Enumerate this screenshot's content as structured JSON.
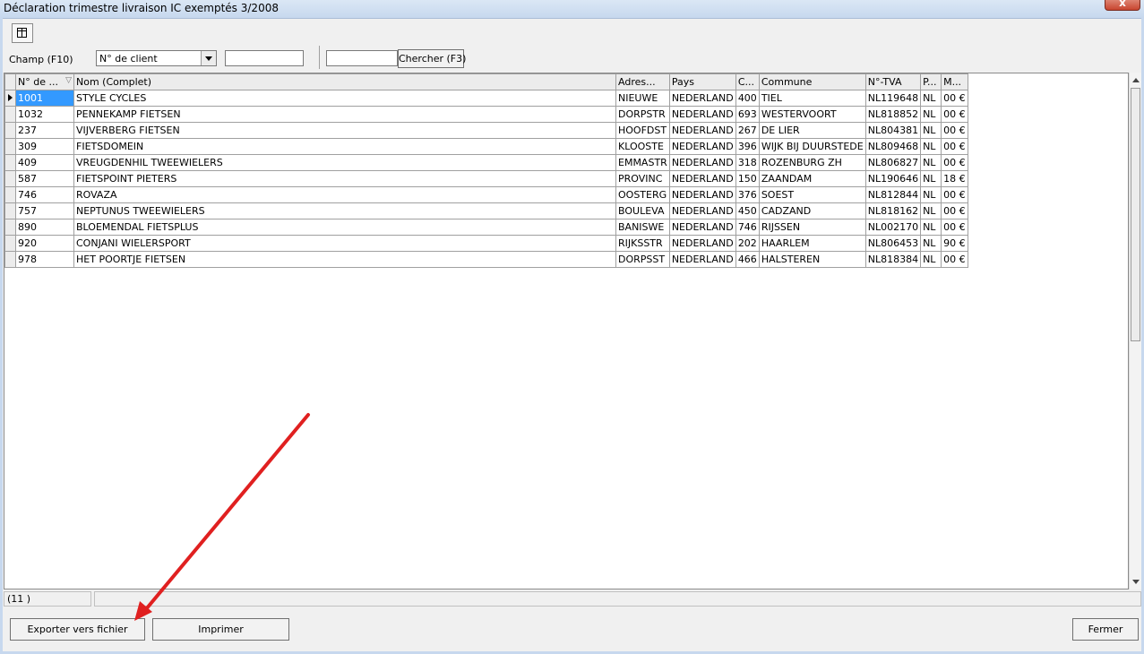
{
  "window": {
    "title": "Déclaration trimestre livraison IC exemptés 3/2008",
    "close": "x"
  },
  "toolbar": {
    "field_label": "Champ (F10)",
    "field_select": "N° de client",
    "value1": "",
    "value2": "",
    "search_button": "Chercher (F3)"
  },
  "grid": {
    "headers": [
      "N° de ...",
      "Nom (Complet)",
      "Adres...",
      "Pays",
      "C...",
      "Commune",
      "N°-TVA",
      "P...",
      "M..."
    ],
    "sort_indicator": "▽",
    "rows": [
      [
        "1001",
        "STYLE CYCLES",
        "NIEUWE",
        "NEDERLAND",
        "400",
        "TIEL",
        "NL119648",
        "NL",
        "00 €"
      ],
      [
        "1032",
        "PENNEKAMP FIETSEN",
        "DORPSTR",
        "NEDERLAND",
        "693",
        "WESTERVOORT",
        "NL818852",
        "NL",
        "00 €"
      ],
      [
        "237",
        "VIJVERBERG FIETSEN",
        "HOOFDST",
        "NEDERLAND",
        "267",
        "DE LIER",
        "NL804381",
        "NL",
        "00 €"
      ],
      [
        "309",
        "FIETSDOMEIN",
        "KLOOSTE",
        "NEDERLAND",
        "396",
        "WIJK BIJ DUURSTEDE",
        "NL809468",
        "NL",
        "00 €"
      ],
      [
        "409",
        "VREUGDENHIL TWEEWIELERS",
        "EMMASTR",
        "NEDERLAND",
        "318",
        "ROZENBURG ZH",
        "NL806827",
        "NL",
        "00 €"
      ],
      [
        "587",
        "FIETSPOINT PIETERS",
        "PROVINC",
        "NEDERLAND",
        "150",
        "ZAANDAM",
        "NL190646",
        "NL",
        "18 €"
      ],
      [
        "746",
        "ROVAZA",
        "OOSTERG",
        "NEDERLAND",
        "376",
        "SOEST",
        "NL812844",
        "NL",
        "00 €"
      ],
      [
        "757",
        "NEPTUNUS TWEEWIELERS",
        "BOULEVA",
        "NEDERLAND",
        "450",
        "CADZAND",
        "NL818162",
        "NL",
        "00 €"
      ],
      [
        "890",
        "BLOEMENDAL FIETSPLUS",
        "BANISWE",
        "NEDERLAND",
        "746",
        "RIJSSEN",
        "NL002170",
        "NL",
        "00 €"
      ],
      [
        "920",
        "CONJANI WIELERSPORT",
        "RIJKSSTR",
        "NEDERLAND",
        "202",
        "HAARLEM",
        "NL806453",
        "NL",
        "90 €"
      ],
      [
        "978",
        "HET POORTJE FIETSEN",
        "DORPSST",
        "NEDERLAND",
        "466",
        "HALSTEREN",
        "NL818384",
        "NL",
        "00 €"
      ]
    ]
  },
  "status": {
    "count": "(11 )",
    "message": ""
  },
  "footer": {
    "export_button": "Exporter vers fichier",
    "print_button": "Imprimer",
    "close_button": "Fermer"
  },
  "annotation_color": "#e02020"
}
